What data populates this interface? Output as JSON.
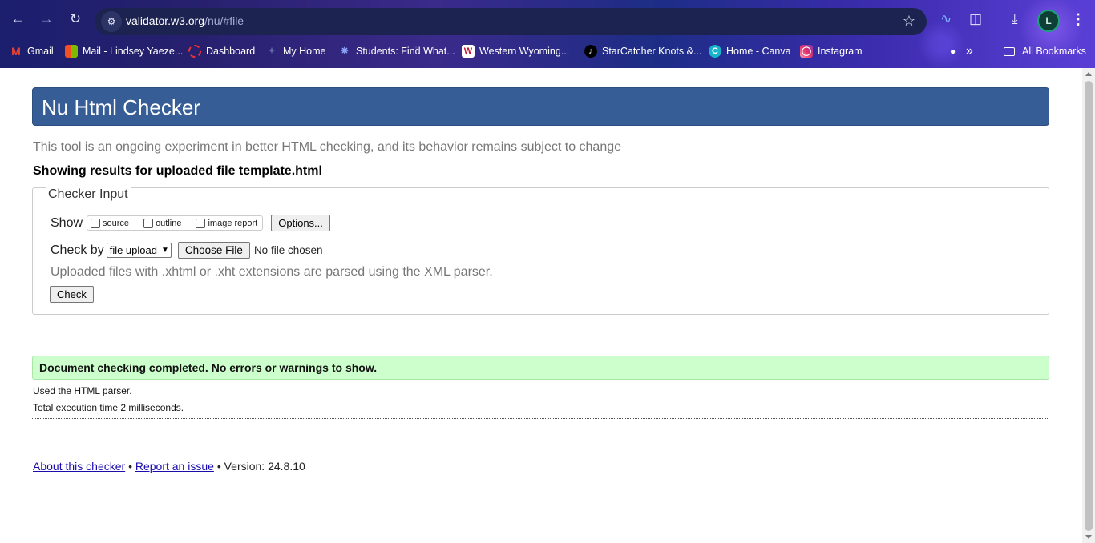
{
  "browser": {
    "url_host": "validator.w3.org",
    "url_path": "/nu/#file",
    "profile_initial": "L",
    "bookmarks": [
      {
        "label": "Gmail",
        "icon": "gmail-icon"
      },
      {
        "label": "Mail - Lindsey Yaeze...",
        "icon": "microsoft-icon"
      },
      {
        "label": "Dashboard",
        "icon": "dashboard-icon"
      },
      {
        "label": "My Home",
        "icon": "myhome-icon"
      },
      {
        "label": "Students: Find What...",
        "icon": "students-icon"
      },
      {
        "label": "Western Wyoming...",
        "icon": "wwcc-icon"
      },
      {
        "label": "StarCatcher Knots &...",
        "icon": "tiktok-icon"
      },
      {
        "label": "Home - Canva",
        "icon": "canva-icon"
      },
      {
        "label": "Instagram",
        "icon": "instagram-icon"
      }
    ],
    "all_bookmarks": "All Bookmarks",
    "overflow": "»"
  },
  "page": {
    "title": "Nu Html Checker",
    "tagline": "This tool is an ongoing experiment in better HTML checking, and its behavior remains subject to change",
    "results_for": "Showing results for uploaded file template.html",
    "checker": {
      "legend": "Checker Input",
      "show_label": "Show",
      "options": [
        "source",
        "outline",
        "image report"
      ],
      "options_button": "Options...",
      "check_by_label": "Check by",
      "check_by_value": "file upload",
      "choose_file": "Choose File",
      "no_file": "No file chosen",
      "note": "Uploaded files with .xhtml or .xht extensions are parsed using the XML parser.",
      "check_button": "Check"
    },
    "result": {
      "message": "Document checking completed. No errors or warnings to show.",
      "parser": "Used the HTML parser.",
      "time": "Total execution time 2 milliseconds."
    },
    "footer": {
      "about": "About this checker",
      "bullet": "•",
      "report": "Report an issue",
      "version": "• Version: 24.8.10"
    }
  },
  "colors": {
    "header_bg": "#365d95",
    "success_bg": "#ccffcc",
    "link": "#1a0dab"
  }
}
